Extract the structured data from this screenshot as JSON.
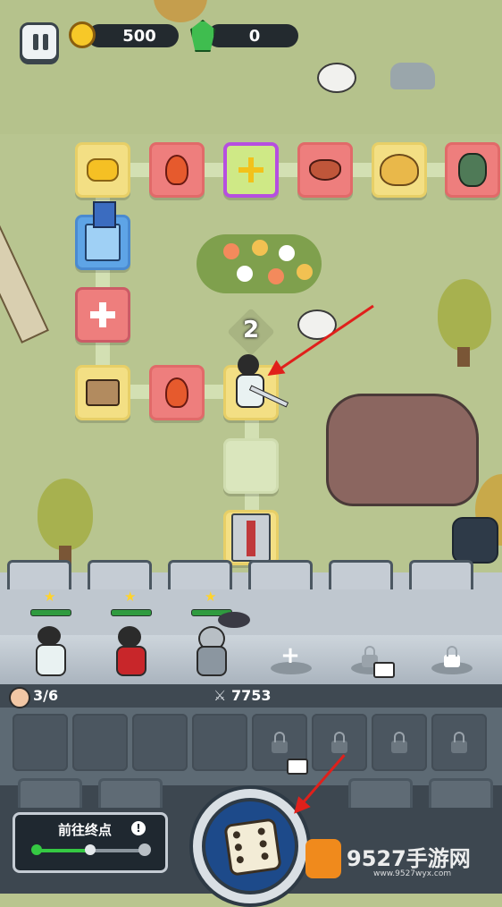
{
  "hud": {
    "gold": "500",
    "gems": "0",
    "gold_icon": "gold-coin-icon",
    "gem_icon": "green-gem-icon",
    "pause_icon": "pause-icon"
  },
  "board": {
    "steps_remaining": "2",
    "tiles": [
      {
        "kind": "gold-nugget"
      },
      {
        "kind": "fire-imp-enemy"
      },
      {
        "kind": "move-arrows"
      },
      {
        "kind": "bat-enemy"
      },
      {
        "kind": "gold-pot"
      },
      {
        "kind": "goblin-enemy"
      },
      {
        "kind": "blue-banner-castle"
      },
      {
        "kind": "health-cross"
      },
      {
        "kind": "treasure-chest"
      },
      {
        "kind": "fire-imp-enemy"
      },
      {
        "kind": "player-hero"
      },
      {
        "kind": "empty"
      },
      {
        "kind": "stone-castle-goal"
      }
    ]
  },
  "party": {
    "count_text": "3/6",
    "power": "7753",
    "heroes": [
      {
        "name": "white-swordsman",
        "stars": 1
      },
      {
        "name": "red-warrior",
        "stars": 1
      },
      {
        "name": "knight",
        "stars": 1
      }
    ],
    "slots": [
      "add-slot",
      "video-unlock-slot",
      "locked-slot"
    ]
  },
  "inventory": {
    "slots": 8
  },
  "goal": {
    "label": "前往终点",
    "progress": 0.5
  },
  "watermark": {
    "text": "9527手游网",
    "url_text": "www.9527wyx.com"
  },
  "colors": {
    "accent_red": "#e0201b",
    "board_green": "#b8c590",
    "castle_grey": "#5d6a74",
    "dice_blue": "#1d4a8a"
  }
}
